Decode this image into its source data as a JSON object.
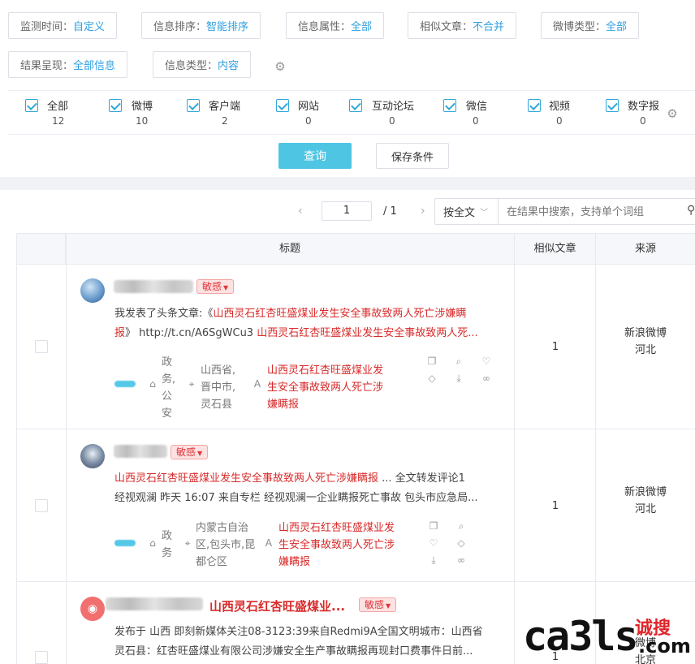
{
  "filters": [
    {
      "label": "监测时间：",
      "value": "自定义"
    },
    {
      "label": "信息排序：",
      "value": "智能排序"
    },
    {
      "label": "信息属性：",
      "value": "全部"
    },
    {
      "label": "相似文章：",
      "value": "不合并"
    },
    {
      "label": "微博类型：",
      "value": "全部"
    },
    {
      "label": "结果呈现：",
      "value": "全部信息"
    },
    {
      "label": "信息类型：",
      "value": "内容"
    }
  ],
  "channels": [
    {
      "name": "全部",
      "count": "12"
    },
    {
      "name": "微博",
      "count": "10"
    },
    {
      "name": "客户端",
      "count": "2"
    },
    {
      "name": "网站",
      "count": "0"
    },
    {
      "name": "互动论坛",
      "count": "0"
    },
    {
      "name": "微信",
      "count": "0"
    },
    {
      "name": "视频",
      "count": "0"
    },
    {
      "name": "数字报",
      "count": "0"
    }
  ],
  "buttons": {
    "query": "查询",
    "save": "保存条件"
  },
  "pager": {
    "current": "1",
    "total": "/ 1",
    "prev": "‹",
    "next": "›"
  },
  "search": {
    "mode": "按全文",
    "placeholder": "在结果中搜索，支持单个词组"
  },
  "table": {
    "headers": {
      "title": "标题",
      "similar": "相似文章",
      "source": "来源"
    }
  },
  "rows": [
    {
      "badge": "敏感",
      "line1_prefix": "我发表了头条文章:《",
      "line1_red": "山西灵石红杏旺盛煤业发生安全事故致两人死亡涉嫌瞒",
      "line2_red1": "报",
      "line2_mid": "》 http://t.cn/A6SgWCu3 ",
      "line2_red2": "山西灵石红杏旺盛煤业发生安全事故致两人死...",
      "tag_gov": "政\n务,\n公\n安",
      "tag_loc": "山西省,\n晋中市,\n灵石县",
      "tag_topic": "山西灵石红杏旺盛煤业发\n生安全事故致两人死亡涉\n嫌瞒报",
      "similar": "1",
      "source1": "新浪微博",
      "source2": "河北"
    },
    {
      "badge": "敏感",
      "line1_red": "山西灵石红杏旺盛煤业发生安全事故致两人死亡涉嫌瞒报",
      "line1_rest": " ... 全文转发评论1",
      "line2": "经视观澜 昨天 16:07 来自专栏 经视观澜一企业瞒报死亡事故 包头市应急局...",
      "tag_gov": "政\n务",
      "tag_loc": "内蒙古自治\n区,包头市,昆\n都仑区",
      "tag_topic": "山西灵石红杏旺盛煤业发\n生安全事故致两人死亡涉\n嫌瞒报",
      "similar": "1",
      "source1": "新浪微博",
      "source2": "河北"
    },
    {
      "title_red": "山西灵石红杏旺盛煤业...",
      "badge": "敏感",
      "line1": "发布于 山西 即刻新媒体关注08-3123:39来自Redmi9A全国文明城市：山西省",
      "line2": "灵石县：红杏旺盛煤业有限公司涉嫌安全生产事故瞒报再现封口费事件日前...",
      "similar": "1",
      "source1": "微博",
      "source2": "北京"
    }
  ],
  "watermark": {
    "brand": "ca3ls",
    "cn": "诚搜",
    "com": ".com"
  },
  "colors": {
    "accent": "#2f9fe0",
    "query_button": "#4fc5e4",
    "sensitive": "#e0363b"
  }
}
